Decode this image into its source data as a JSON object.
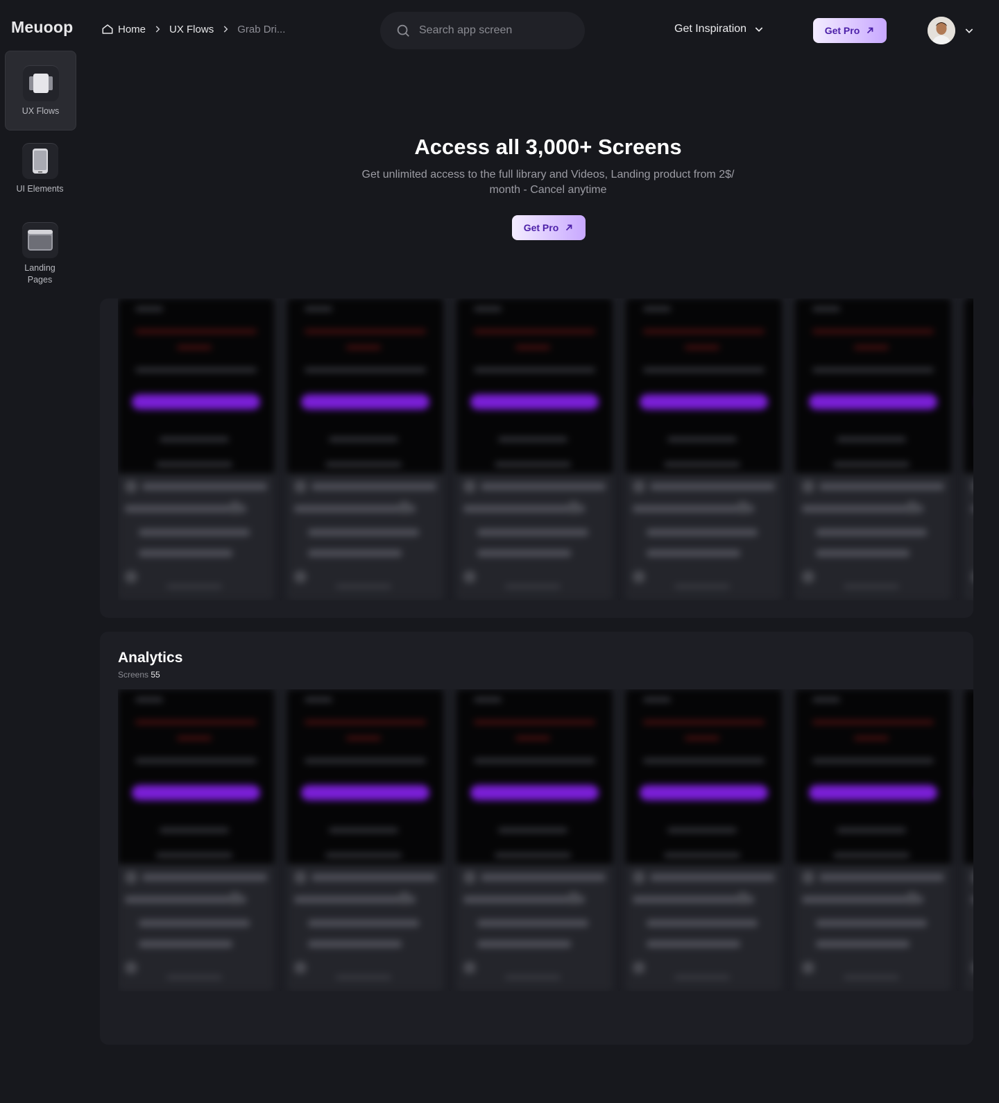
{
  "app": {
    "logo": "Meuoop"
  },
  "breadcrumb": {
    "home": "Home",
    "section": "UX Flows",
    "current": "Grab Dri..."
  },
  "search": {
    "placeholder": "Search app screen"
  },
  "header": {
    "inspiration_label": "Get Inspiration",
    "pro_label": "Get Pro"
  },
  "sidebar": {
    "items": [
      {
        "label": "UX Flows",
        "icon": "stack-icon",
        "active": true
      },
      {
        "label": "UI Elements",
        "icon": "phone-icon",
        "active": false
      },
      {
        "label": "Landing Pages",
        "icon": "browser-icon",
        "active": false
      }
    ]
  },
  "hero": {
    "title": "Access all 3,000+ Screens",
    "subtitle": "Get unlimited access to the full library and Videos, Landing product from 2$/ month - Cancel anytime",
    "pro_label": "Get Pro"
  },
  "sections": [
    {
      "title": "Analytics",
      "screens_label": "Screens",
      "screens_count": "55"
    }
  ],
  "colors": {
    "background": "#17181d",
    "panel": "#1d1e24",
    "accent": "#7a1fd6",
    "pro_gradient_start": "#f3ecff",
    "pro_gradient_end": "#c8a8ff"
  }
}
